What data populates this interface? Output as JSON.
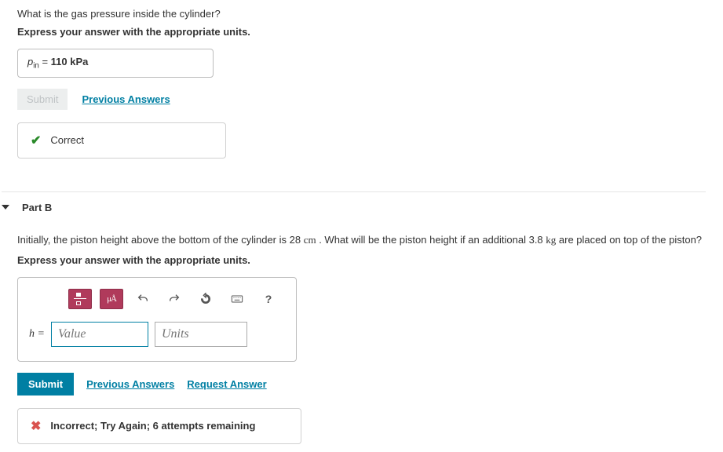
{
  "partA": {
    "question": "What is the gas pressure inside the cylinder?",
    "instruction": "Express your answer with the appropriate units.",
    "answer_var": "p",
    "answer_sub": "in",
    "answer_eq": " = ",
    "answer_value": "110 kPa",
    "submit_label": "Submit",
    "prev_answers_label": "Previous Answers",
    "feedback": "Correct"
  },
  "partB": {
    "title": "Part B",
    "question_pre": "Initially, the piston height above the bottom of the cylinder is 28 ",
    "question_unit1": "cm",
    "question_mid": " . What will be the piston height if an additional 3.8 ",
    "question_unit2": "kg",
    "question_post": " are placed on top of the piston?",
    "instruction": "Express your answer with the appropriate units.",
    "h_label": "h =",
    "value_placeholder": "Value",
    "units_placeholder": "Units",
    "submit_label": "Submit",
    "prev_answers_label": "Previous Answers",
    "request_answer_label": "Request Answer",
    "feedback": "Incorrect; Try Again; 6 attempts remaining",
    "toolbar": {
      "fraction": "fraction",
      "xsup": "μÅ",
      "undo": "undo",
      "redo": "redo",
      "reset": "reset",
      "keyboard": "keyboard",
      "help": "?"
    }
  }
}
